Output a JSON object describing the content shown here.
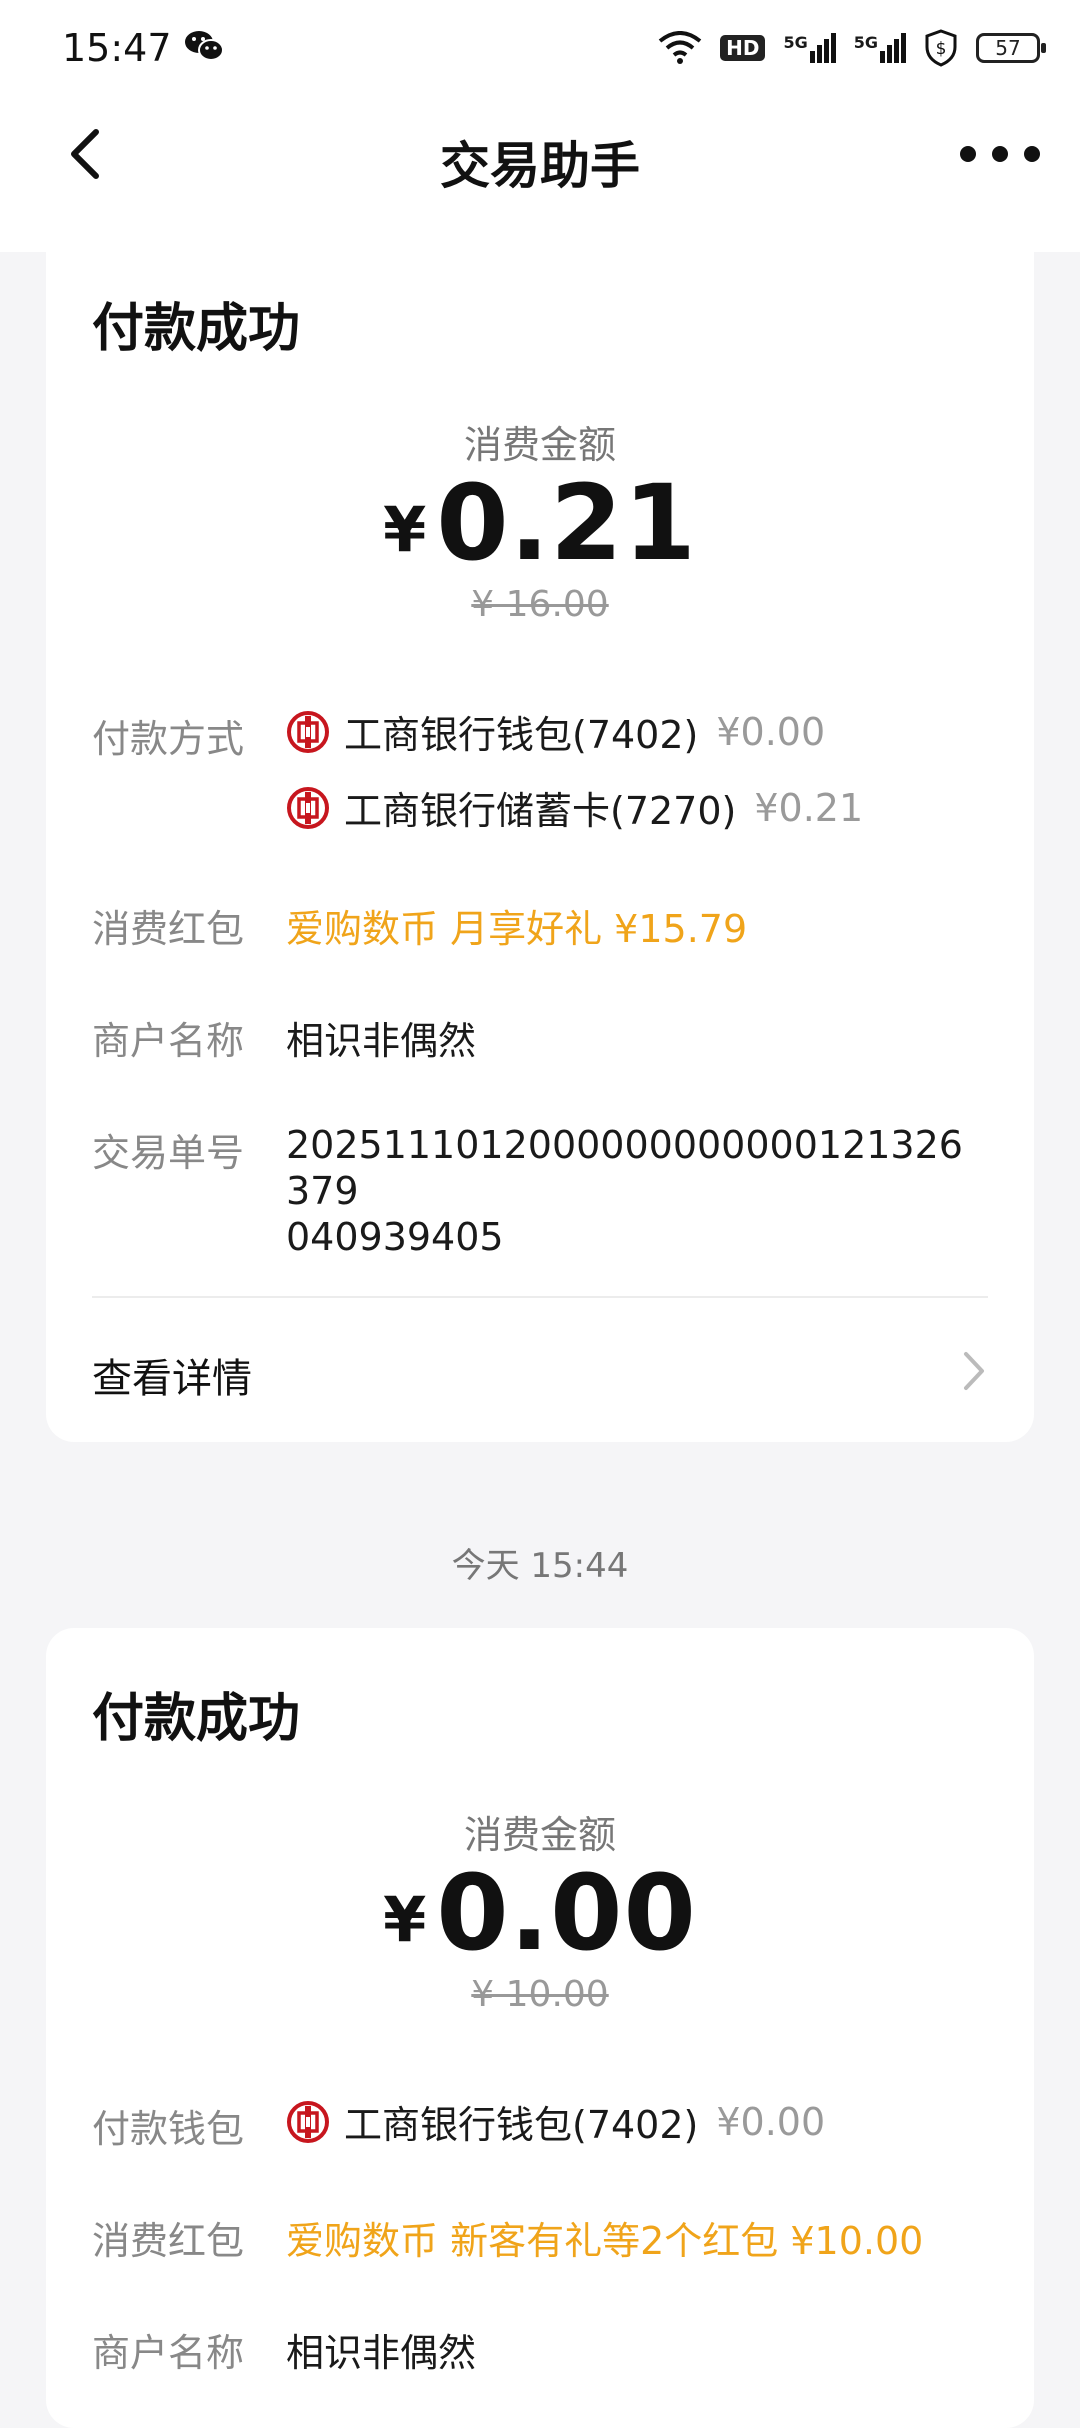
{
  "status_bar": {
    "time": "15:47",
    "hd_label": "HD",
    "net1": "5G",
    "net2": "5G",
    "battery": "57"
  },
  "nav": {
    "title": "交易助手"
  },
  "cards": [
    {
      "heading": "付款成功",
      "amount_label": "消费金额",
      "currency": "¥",
      "amount": "0.21",
      "original_amount": "¥ 16.00",
      "payment_label": "付款方式",
      "payments": [
        {
          "name": "工商银行钱包(7402)",
          "amount": "¥0.00"
        },
        {
          "name": "工商银行储蓄卡(7270)",
          "amount": "¥0.21"
        }
      ],
      "redpacket_label": "消费红包",
      "redpacket_value": "爱购数币 月享好礼  ¥15.79",
      "merchant_label": "商户名称",
      "merchant_value": "相识非偶然",
      "order_label": "交易单号",
      "order_line1": "2025111012000000000000121326379",
      "order_line2": "040939405",
      "detail_link": "查看详情"
    },
    {
      "heading": "付款成功",
      "amount_label": "消费金额",
      "currency": "¥",
      "amount": "0.00",
      "original_amount": "¥ 10.00",
      "payment_label": "付款钱包",
      "payments": [
        {
          "name": "工商银行钱包(7402)",
          "amount": "¥0.00"
        }
      ],
      "redpacket_label": "消费红包",
      "redpacket_value": "爱购数币 新客有礼等2个红包  ¥10.00",
      "merchant_label": "商户名称",
      "merchant_value": "相识非偶然"
    }
  ],
  "timestamp": "今天 15:44",
  "colors": {
    "accent_orange": "#f0a41a",
    "icbc_red": "#c7161e",
    "background": "#f5f5f7"
  }
}
